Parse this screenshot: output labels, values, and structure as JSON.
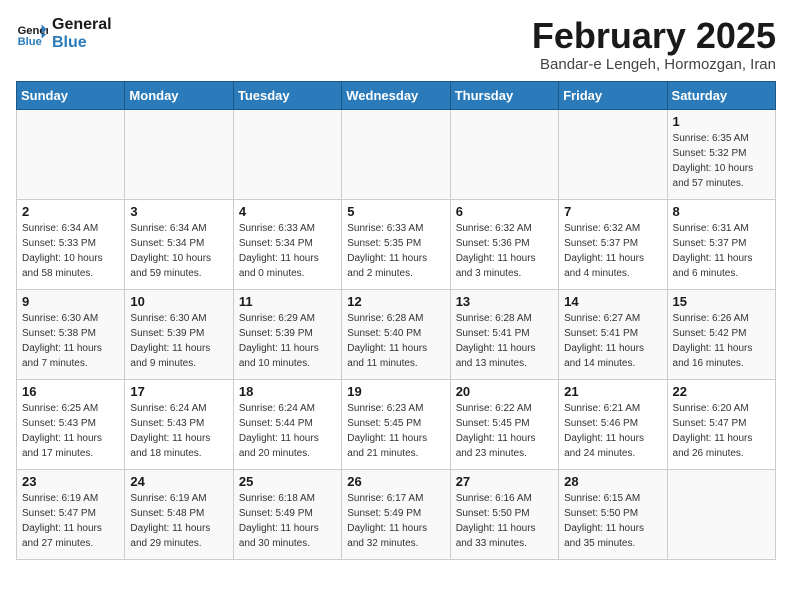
{
  "header": {
    "logo_line1": "General",
    "logo_line2": "Blue",
    "month": "February 2025",
    "location": "Bandar-e Lengeh, Hormozgan, Iran"
  },
  "days_of_week": [
    "Sunday",
    "Monday",
    "Tuesday",
    "Wednesday",
    "Thursday",
    "Friday",
    "Saturday"
  ],
  "weeks": [
    [
      {
        "day": "",
        "info": ""
      },
      {
        "day": "",
        "info": ""
      },
      {
        "day": "",
        "info": ""
      },
      {
        "day": "",
        "info": ""
      },
      {
        "day": "",
        "info": ""
      },
      {
        "day": "",
        "info": ""
      },
      {
        "day": "1",
        "info": "Sunrise: 6:35 AM\nSunset: 5:32 PM\nDaylight: 10 hours and 57 minutes."
      }
    ],
    [
      {
        "day": "2",
        "info": "Sunrise: 6:34 AM\nSunset: 5:33 PM\nDaylight: 10 hours and 58 minutes."
      },
      {
        "day": "3",
        "info": "Sunrise: 6:34 AM\nSunset: 5:34 PM\nDaylight: 10 hours and 59 minutes."
      },
      {
        "day": "4",
        "info": "Sunrise: 6:33 AM\nSunset: 5:34 PM\nDaylight: 11 hours and 0 minutes."
      },
      {
        "day": "5",
        "info": "Sunrise: 6:33 AM\nSunset: 5:35 PM\nDaylight: 11 hours and 2 minutes."
      },
      {
        "day": "6",
        "info": "Sunrise: 6:32 AM\nSunset: 5:36 PM\nDaylight: 11 hours and 3 minutes."
      },
      {
        "day": "7",
        "info": "Sunrise: 6:32 AM\nSunset: 5:37 PM\nDaylight: 11 hours and 4 minutes."
      },
      {
        "day": "8",
        "info": "Sunrise: 6:31 AM\nSunset: 5:37 PM\nDaylight: 11 hours and 6 minutes."
      }
    ],
    [
      {
        "day": "9",
        "info": "Sunrise: 6:30 AM\nSunset: 5:38 PM\nDaylight: 11 hours and 7 minutes."
      },
      {
        "day": "10",
        "info": "Sunrise: 6:30 AM\nSunset: 5:39 PM\nDaylight: 11 hours and 9 minutes."
      },
      {
        "day": "11",
        "info": "Sunrise: 6:29 AM\nSunset: 5:39 PM\nDaylight: 11 hours and 10 minutes."
      },
      {
        "day": "12",
        "info": "Sunrise: 6:28 AM\nSunset: 5:40 PM\nDaylight: 11 hours and 11 minutes."
      },
      {
        "day": "13",
        "info": "Sunrise: 6:28 AM\nSunset: 5:41 PM\nDaylight: 11 hours and 13 minutes."
      },
      {
        "day": "14",
        "info": "Sunrise: 6:27 AM\nSunset: 5:41 PM\nDaylight: 11 hours and 14 minutes."
      },
      {
        "day": "15",
        "info": "Sunrise: 6:26 AM\nSunset: 5:42 PM\nDaylight: 11 hours and 16 minutes."
      }
    ],
    [
      {
        "day": "16",
        "info": "Sunrise: 6:25 AM\nSunset: 5:43 PM\nDaylight: 11 hours and 17 minutes."
      },
      {
        "day": "17",
        "info": "Sunrise: 6:24 AM\nSunset: 5:43 PM\nDaylight: 11 hours and 18 minutes."
      },
      {
        "day": "18",
        "info": "Sunrise: 6:24 AM\nSunset: 5:44 PM\nDaylight: 11 hours and 20 minutes."
      },
      {
        "day": "19",
        "info": "Sunrise: 6:23 AM\nSunset: 5:45 PM\nDaylight: 11 hours and 21 minutes."
      },
      {
        "day": "20",
        "info": "Sunrise: 6:22 AM\nSunset: 5:45 PM\nDaylight: 11 hours and 23 minutes."
      },
      {
        "day": "21",
        "info": "Sunrise: 6:21 AM\nSunset: 5:46 PM\nDaylight: 11 hours and 24 minutes."
      },
      {
        "day": "22",
        "info": "Sunrise: 6:20 AM\nSunset: 5:47 PM\nDaylight: 11 hours and 26 minutes."
      }
    ],
    [
      {
        "day": "23",
        "info": "Sunrise: 6:19 AM\nSunset: 5:47 PM\nDaylight: 11 hours and 27 minutes."
      },
      {
        "day": "24",
        "info": "Sunrise: 6:19 AM\nSunset: 5:48 PM\nDaylight: 11 hours and 29 minutes."
      },
      {
        "day": "25",
        "info": "Sunrise: 6:18 AM\nSunset: 5:49 PM\nDaylight: 11 hours and 30 minutes."
      },
      {
        "day": "26",
        "info": "Sunrise: 6:17 AM\nSunset: 5:49 PM\nDaylight: 11 hours and 32 minutes."
      },
      {
        "day": "27",
        "info": "Sunrise: 6:16 AM\nSunset: 5:50 PM\nDaylight: 11 hours and 33 minutes."
      },
      {
        "day": "28",
        "info": "Sunrise: 6:15 AM\nSunset: 5:50 PM\nDaylight: 11 hours and 35 minutes."
      },
      {
        "day": "",
        "info": ""
      }
    ]
  ]
}
